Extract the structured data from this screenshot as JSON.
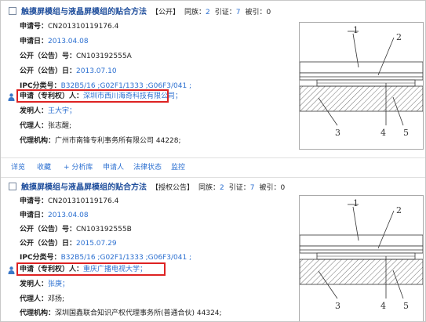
{
  "records": [
    {
      "title": "触摸屏模组与液晶屏模组的贴合方法",
      "status": "【公开】",
      "family_label": "同族：",
      "family_count": "2",
      "cite_label": "引证：",
      "cite_count": "7",
      "cited_label": "被引：",
      "cited_count": "0",
      "app_no_label": "申请号：",
      "app_no": "CN201310119176.4",
      "app_date_label": "申请日：",
      "app_date": "2013.04.08",
      "pub_no_label": "公开（公告）号：",
      "pub_no": "CN103192555A",
      "pub_date_label": "公开（公告）日：",
      "pub_date": "2013.07.10",
      "ipc_label": "IPC分类号：",
      "ipc": "B32B5/16 ;G02F1/1333 ;G06F3/041 ;",
      "applicant_label": "申请（专利权）人：",
      "applicant": "深圳市西川海奇科技有限公司；",
      "inventor_label": "发明人：",
      "inventor": "王大宇；",
      "agent_label": "代理人：",
      "agent": "张志醒;",
      "agency_label": "代理机构：",
      "agency": "广州市南锋专利事务所有限公司 44228;"
    },
    {
      "title": "触摸屏模组与液晶屏模组的贴合方法",
      "status": "【授权公告】",
      "family_label": "同族：",
      "family_count": "2",
      "cite_label": "引证：",
      "cite_count": "7",
      "cited_label": "被引：",
      "cited_count": "0",
      "app_no_label": "申请号：",
      "app_no": "CN201310119176.4",
      "app_date_label": "申请日：",
      "app_date": "2013.04.08",
      "pub_no_label": "公开（公告）号：",
      "pub_no": "CN103192555B",
      "pub_date_label": "公开（公告）日：",
      "pub_date": "2015.07.29",
      "ipc_label": "IPC分类号：",
      "ipc": "B32B5/16 ;G02F1/1333 ;G06F3/041 ;",
      "applicant_label": "申请（专利权）人：",
      "applicant": "重庆广播电视大学；",
      "inventor_label": "发明人：",
      "inventor": "张庚；",
      "agent_label": "代理人：",
      "agent": "邓扬;",
      "agency_label": "代理机构：",
      "agency": "深圳国鑫联合知识产权代理事务所(普通合伙) 44324;"
    }
  ],
  "toolbar": {
    "detail": "详览",
    "favorite": "收藏",
    "analyze": "+ 分析库",
    "applicant": "申请人",
    "legal_status": "法律状态",
    "monitor": "监控"
  },
  "figure_labels": [
    "1",
    "2",
    "3",
    "4",
    "5"
  ],
  "colors": {
    "link": "#2b6fd0",
    "title": "#1f4e9c",
    "highlight": "#dd2222"
  }
}
